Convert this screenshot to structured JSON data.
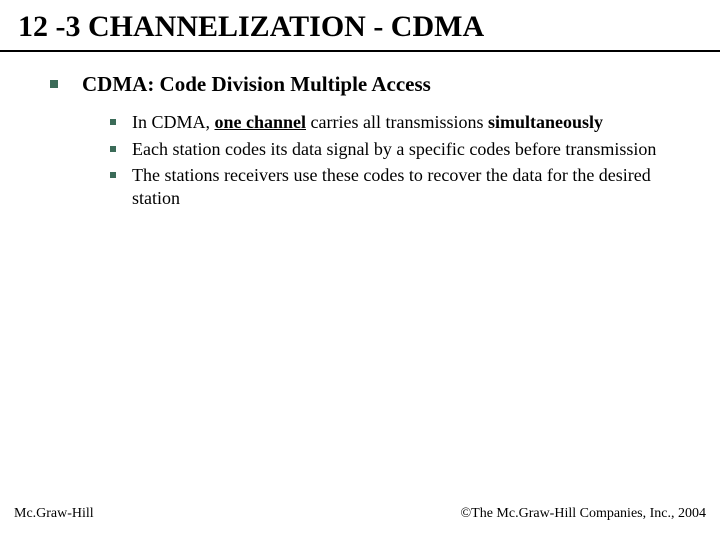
{
  "title": "12 -3   CHANNELIZATION - CDMA",
  "level1": {
    "text": "CDMA: Code Division Multiple Access"
  },
  "bullets": [
    {
      "pre": "In CDMA, ",
      "underline": "one channel",
      "post": " carries all transmissions ",
      "bold": "simultaneously"
    },
    {
      "text": "Each station codes its data signal by a specific codes before transmission"
    },
    {
      "text": "The stations receivers  use these codes to recover the data for the desired station"
    }
  ],
  "footer": {
    "left": "Mc.Graw-Hill",
    "right": "©The Mc.Graw-Hill Companies, Inc., 2004"
  }
}
